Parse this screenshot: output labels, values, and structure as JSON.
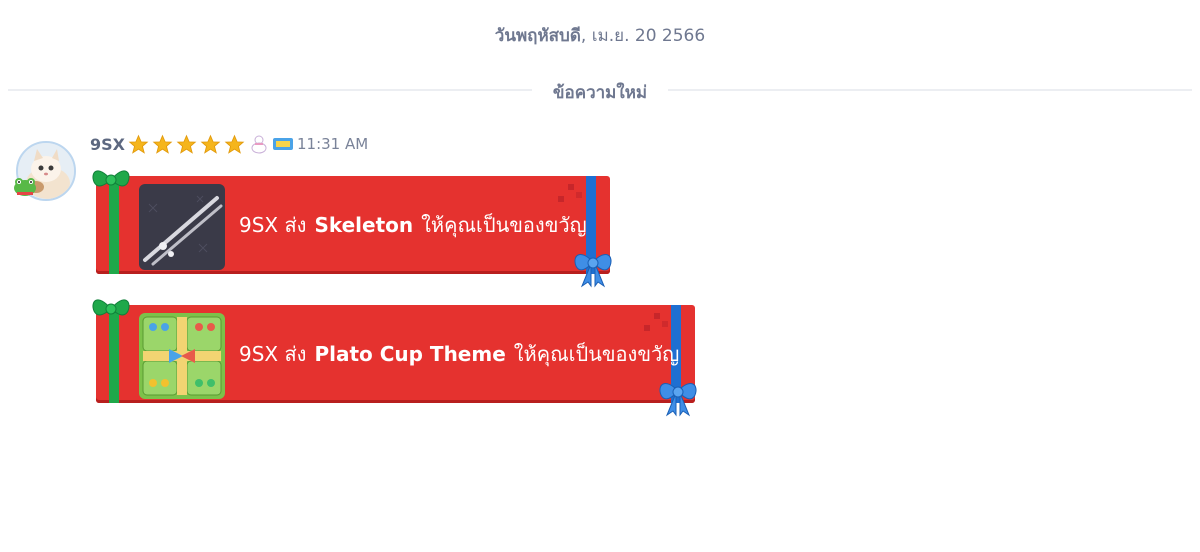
{
  "header": {
    "day": "วันพฤหัสบดี",
    "date_rest": ", เม.ย. 20 2566"
  },
  "divider": {
    "label": "ข้อความใหม่"
  },
  "message": {
    "username": "9SX",
    "stars": 5,
    "time": "11:31 AM",
    "gifts": [
      {
        "sender": "9SX ส่ง",
        "item": "Skeleton",
        "suffix": "ให้คุณเป็นของขวัญ",
        "thumb": "skeleton-cue-thumbnail"
      },
      {
        "sender": "9SX ส่ง",
        "item": "Plato Cup Theme",
        "suffix": "ให้คุณเป็นของขวัญ",
        "thumb": "plato-cup-theme-thumbnail"
      }
    ]
  },
  "colors": {
    "gift_red": "#e5322f",
    "ribbon_green": "#1fa84a",
    "ribbon_blue": "#1f6fd1",
    "star": "#f5b51c",
    "text_muted": "#6f7890"
  }
}
